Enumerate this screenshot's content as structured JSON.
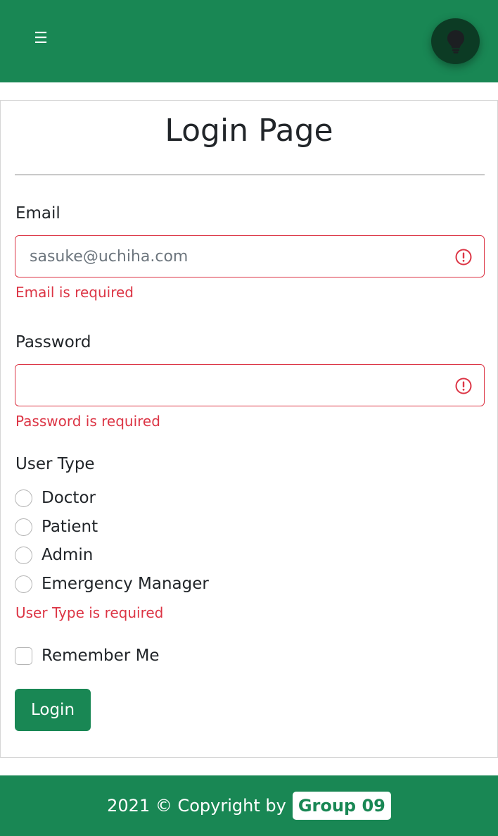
{
  "header": {
    "menu_icon": "hamburger-menu-icon",
    "theme_icon": "lightbulb-icon",
    "menu_glyph": "☰"
  },
  "page": {
    "title": "Login Page"
  },
  "form": {
    "email": {
      "label": "Email",
      "placeholder": "sasuke@uchiha.com",
      "value": "",
      "error": "Email is required"
    },
    "password": {
      "label": "Password",
      "placeholder": "",
      "value": "",
      "error": "Password is required"
    },
    "user_type": {
      "label": "User Type",
      "options": [
        "Doctor",
        "Patient",
        "Admin",
        "Emergency Manager"
      ],
      "selected": null,
      "error": "User Type is required"
    },
    "remember_me": {
      "label": "Remember Me",
      "checked": false
    },
    "submit_label": "Login"
  },
  "footer": {
    "text": "2021 © Copyright by",
    "badge": "Group 09"
  },
  "colors": {
    "primary": "#198754",
    "danger": "#dc3545",
    "theme_button": "#0c3b24"
  }
}
